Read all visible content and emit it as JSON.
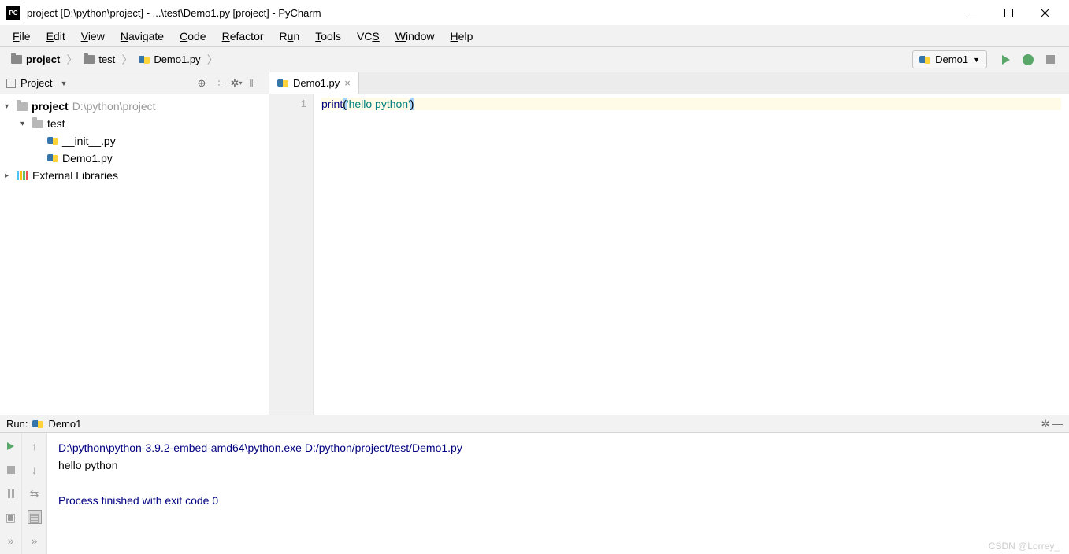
{
  "title": "project [D:\\python\\project] - ...\\test\\Demo1.py [project] - PyCharm",
  "menu": [
    "File",
    "Edit",
    "View",
    "Navigate",
    "Code",
    "Refactor",
    "Run",
    "Tools",
    "VCS",
    "Window",
    "Help"
  ],
  "crumbs": {
    "project": "project",
    "folder": "test",
    "file": "Demo1.py"
  },
  "run_config": "Demo1",
  "panel_title": "Project",
  "tree": {
    "project_name": "project",
    "project_path": "D:\\python\\project",
    "folder": "test",
    "file_init": "__init__.py",
    "file_demo": "Demo1.py",
    "external": "External Libraries"
  },
  "editor": {
    "tab": "Demo1.py",
    "line_no": "1",
    "code_kw": "print",
    "code_p1": "(",
    "code_str": "'hello python'",
    "code_p2": ")"
  },
  "run": {
    "label": "Run:",
    "name": "Demo1",
    "cmd": "D:\\python\\python-3.9.2-embed-amd64\\python.exe D:/python/project/test/Demo1.py",
    "out": "hello python",
    "exit": "Process finished with exit code 0"
  },
  "watermark": "CSDN @Lorrey_"
}
